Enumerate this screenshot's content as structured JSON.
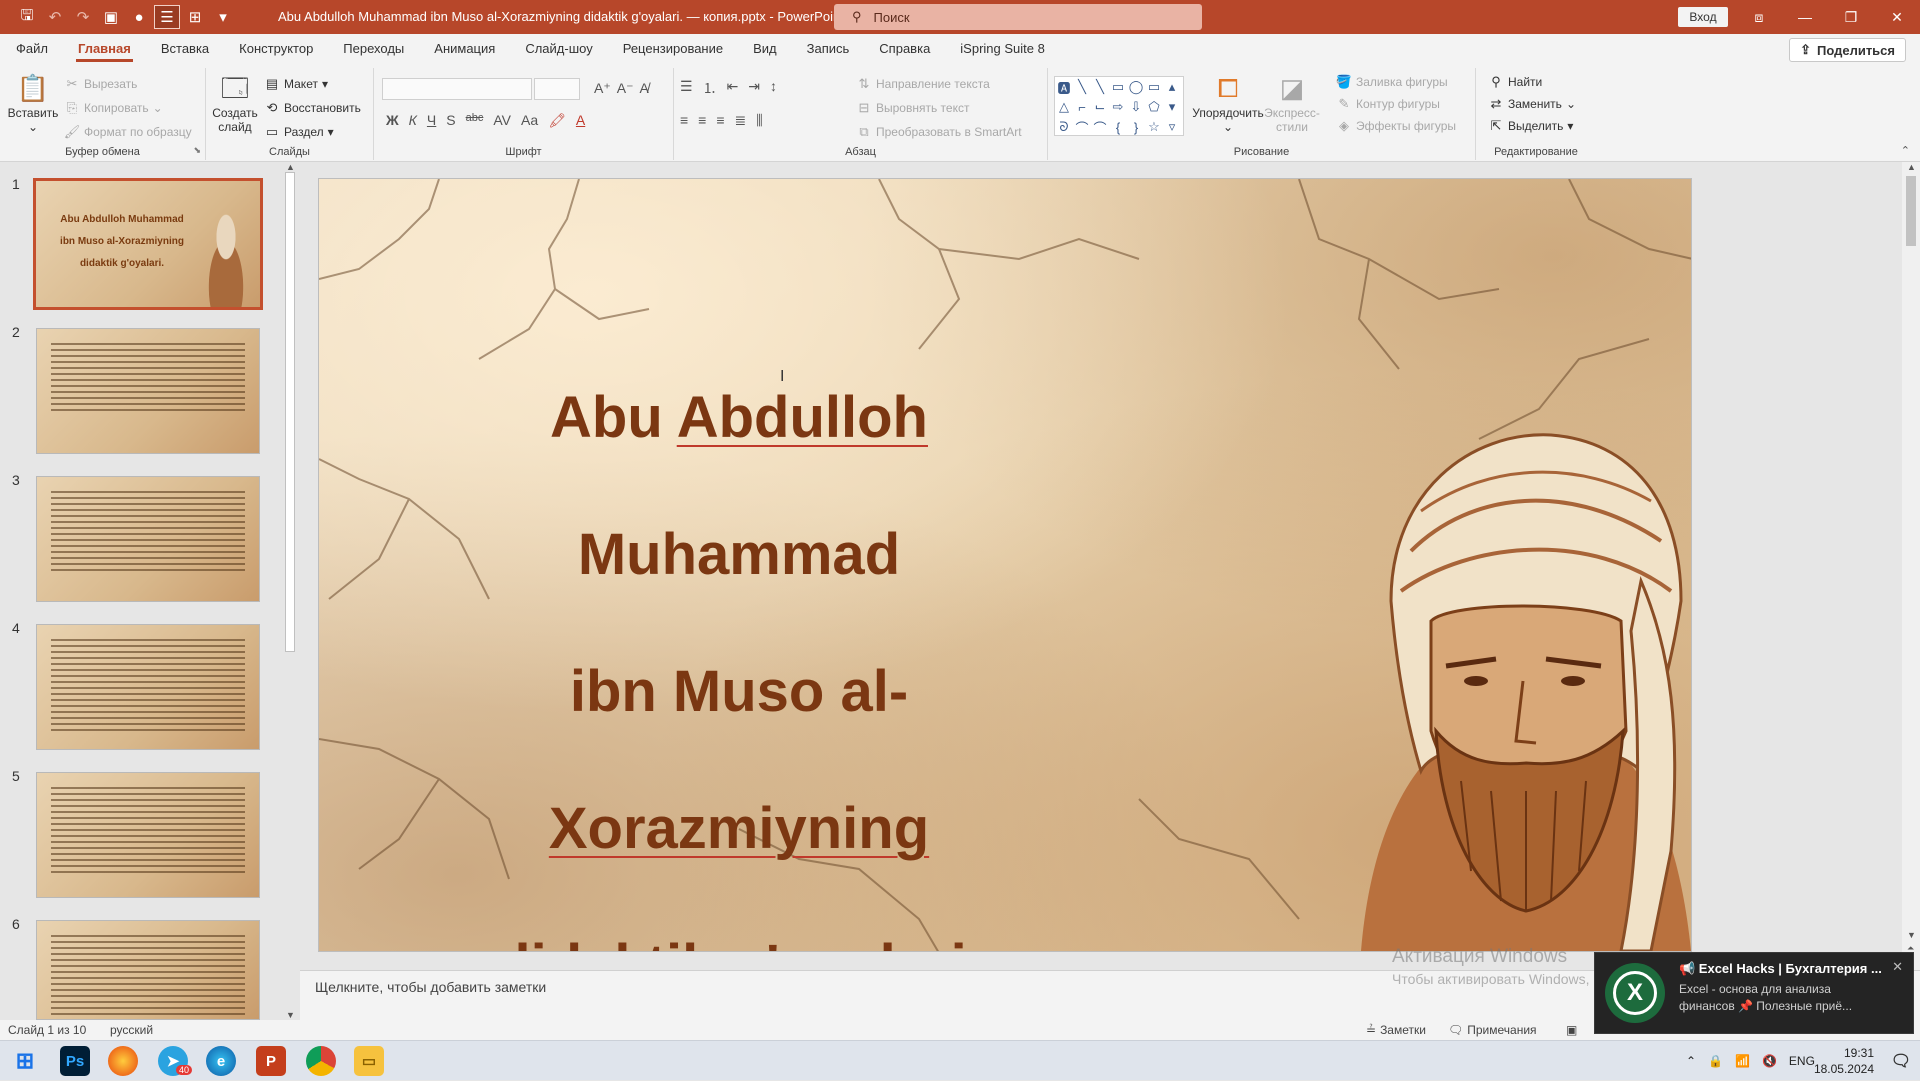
{
  "window": {
    "doc_title": "Abu Abdulloh Muhammad ibn Muso al-Xorazmiyning didaktik g'oyalari. — копия.pptx  -  PowerPoint",
    "search_placeholder": "Поиск",
    "signin_label": "Вход"
  },
  "tabs": [
    "Файл",
    "Главная",
    "Вставка",
    "Конструктор",
    "Переходы",
    "Анимация",
    "Слайд-шоу",
    "Рецензирование",
    "Вид",
    "Запись",
    "Справка",
    "iSpring Suite 8"
  ],
  "share_label": "Поделиться",
  "ribbon": {
    "clipboard": {
      "paste": "Вставить",
      "cut": "Вырезать",
      "copy": "Копировать",
      "format_painter": "Формат по образцу",
      "label": "Буфер обмена"
    },
    "slides": {
      "new_slide_1": "Создать",
      "new_slide_2": "слайд",
      "layout": "Макет",
      "reset": "Восстановить",
      "section": "Раздел",
      "label": "Слайды"
    },
    "font": {
      "bold": "Ж",
      "italic": "К",
      "underline": "Ч",
      "shadow": "S",
      "strike": "abc",
      "case": "Aa",
      "label": "Шрифт"
    },
    "paragraph": {
      "text_direction": "Направление текста",
      "align_text": "Выровнять текст",
      "smartart": "Преобразовать в SmartArt",
      "label": "Абзац"
    },
    "drawing": {
      "arrange": "Упорядочить",
      "quick_styles_1": "Экспресс-",
      "quick_styles_2": "стили",
      "shape_fill": "Заливка фигуры",
      "shape_outline": "Контур фигуры",
      "shape_effects": "Эффекты фигуры",
      "label": "Рисование"
    },
    "editing": {
      "find": "Найти",
      "replace": "Заменить",
      "select": "Выделить",
      "label": "Редактирование"
    }
  },
  "thumbnails": [
    {
      "num": "1",
      "title": "Abu Abdulloh Muhammad ibn Muso al-Xorazmiyning didaktik g'oyalari."
    },
    {
      "num": "2"
    },
    {
      "num": "3"
    },
    {
      "num": "4"
    },
    {
      "num": "5"
    },
    {
      "num": "6"
    }
  ],
  "slide": {
    "title_line1_a": "Abu ",
    "title_line1_b": "Abdulloh",
    "title_line1_c": " Muhammad",
    "title_line2_a": "ibn Muso al-",
    "title_line2_b": "Xorazmiyning",
    "title_line3_a": "didaktik",
    "title_line3_b": " ",
    "title_line3_c": "g'oyalari",
    "title_line3_d": "."
  },
  "notes_placeholder": "Щелкните, чтобы добавить заметки",
  "activation": {
    "title": "Активация Windows",
    "subtitle": "Чтобы активировать Windows, перейдите в раздел \"Параметры\"."
  },
  "status": {
    "slide_count": "Слайд 1 из 10",
    "language": "русский",
    "notes": "Заметки",
    "comments": "Примечания"
  },
  "toast": {
    "title": "📢 Excel Hacks | Бухгалтерия ...",
    "body": "Excel - основа для анализа финансов 📌 Полезные приё..."
  },
  "taskbar": {
    "lang": "ENG",
    "time": "19:31",
    "date": "18.05.2024",
    "telegram_badge": "40"
  },
  "colors": {
    "accent": "#b7472a",
    "slide_title": "#7b3712"
  }
}
